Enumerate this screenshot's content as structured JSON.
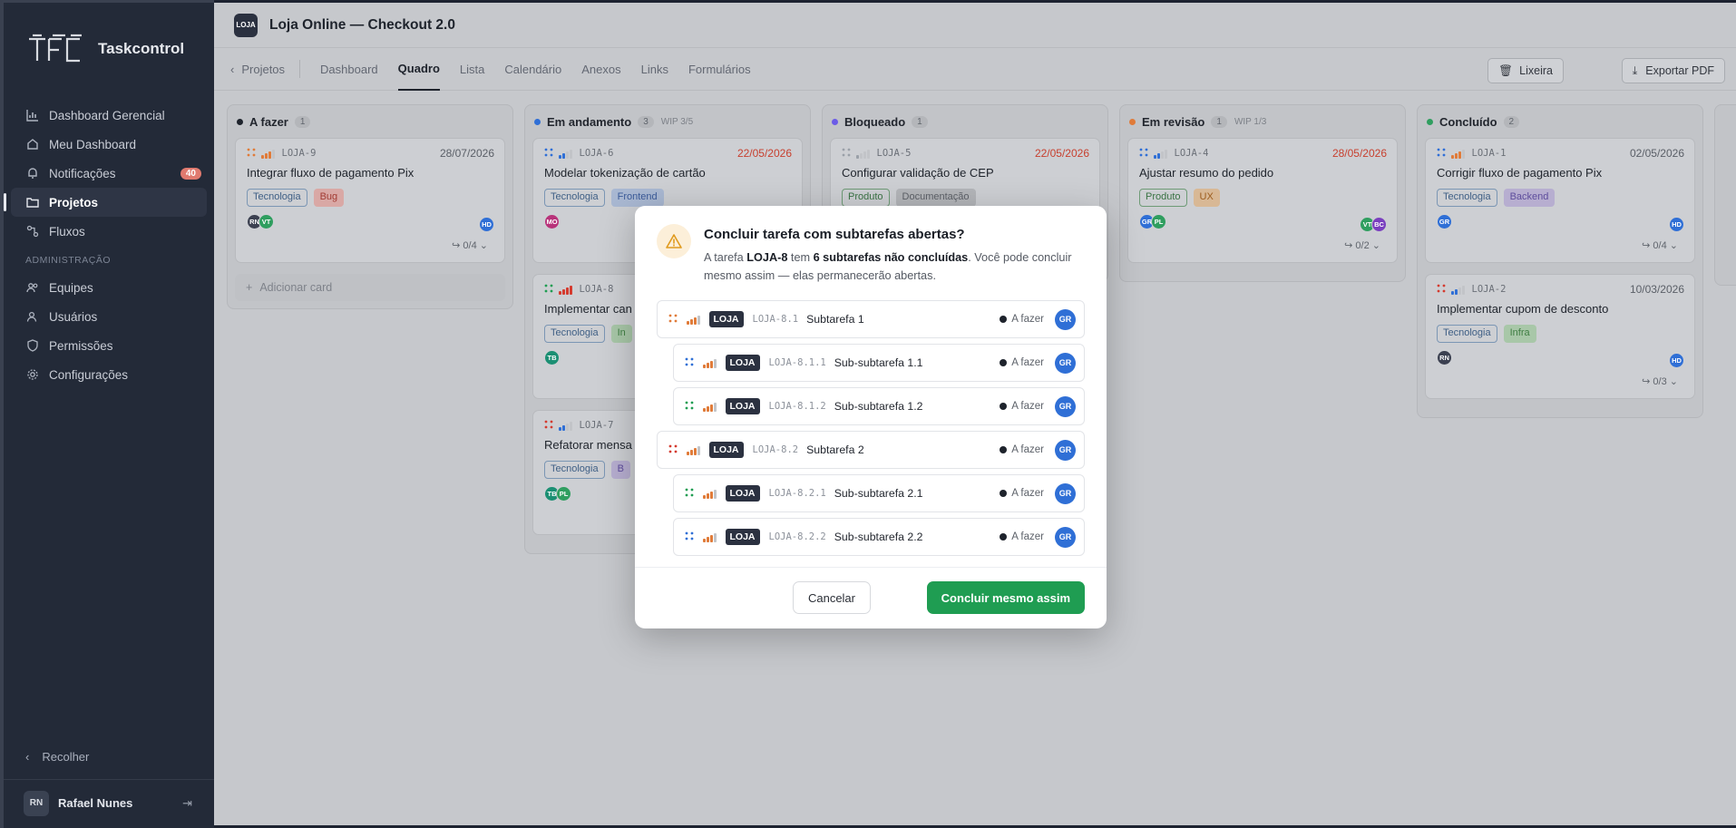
{
  "app": {
    "name": "Taskcontrol"
  },
  "sidebar": {
    "items": [
      {
        "label": "Dashboard Gerencial",
        "icon": "bar-chart-icon"
      },
      {
        "label": "Meu Dashboard",
        "icon": "home-icon"
      },
      {
        "label": "Notificações",
        "icon": "bell-icon",
        "count": "40"
      },
      {
        "label": "Projetos",
        "icon": "folder-icon",
        "active": true
      },
      {
        "label": "Fluxos",
        "icon": "flow-icon"
      }
    ],
    "section_label": "ADMINISTRAÇÃO",
    "admin_items": [
      {
        "label": "Equipes",
        "icon": "team-icon"
      },
      {
        "label": "Usuários",
        "icon": "users-icon"
      },
      {
        "label": "Permissões",
        "icon": "shield-icon"
      },
      {
        "label": "Configurações",
        "icon": "gear-icon"
      }
    ],
    "collapse_label": "Recolher",
    "user": {
      "initials": "RN",
      "name": "Rafael Nunes"
    }
  },
  "project": {
    "badge": "LOJA",
    "title": "Loja Online — Checkout 2.0"
  },
  "tabs": {
    "back": "Projetos",
    "items": [
      "Dashboard",
      "Quadro",
      "Lista",
      "Calendário",
      "Anexos",
      "Links",
      "Formulários"
    ],
    "active": "Quadro"
  },
  "actions": {
    "trash": "Lixeira",
    "export": "Exportar PDF"
  },
  "columns": [
    {
      "name": "A fazer",
      "count": "1",
      "wip": "",
      "color": "#1e232c",
      "cards": [
        {
          "key": "LOJA-9",
          "date": "28/07/2026",
          "late": false,
          "title": "Integrar fluxo de pagamento Pix",
          "tags": [
            {
              "t": "Tecnologia",
              "c": "tec"
            },
            {
              "t": "Bug",
              "c": "red"
            }
          ],
          "avatars": [
            {
              "i": "RN",
              "c": "#3b4050"
            },
            {
              "i": "VT",
              "c": "#2f9e5f"
            }
          ],
          "right_avatar": {
            "i": "HD",
            "c": "#2f6fd6"
          },
          "subcount": "0/4"
        }
      ],
      "add_label": "Adicionar card"
    },
    {
      "name": "Em andamento",
      "count": "3",
      "wip": "WIP 3/5",
      "color": "#2f6fd6",
      "cards": [
        {
          "key": "LOJA-6",
          "date": "22/05/2026",
          "late": true,
          "title": "Modelar tokenização de cartão",
          "tags": [
            {
              "t": "Tecnologia",
              "c": "tec"
            },
            {
              "t": "Frontend",
              "c": "blue"
            }
          ],
          "avatars": [
            {
              "i": "MO",
              "c": "#b8337a"
            }
          ],
          "right_avatar": null,
          "subcount": ""
        },
        {
          "key": "LOJA-8",
          "date": "",
          "late": false,
          "title": "Implementar can",
          "tags": [
            {
              "t": "Tecnologia",
              "c": "tec"
            },
            {
              "t": "In",
              "c": "green"
            }
          ],
          "avatars": [
            {
              "i": "TB",
              "c": "#1b8f73"
            }
          ],
          "right_avatar": null,
          "subcount": ""
        },
        {
          "key": "LOJA-7",
          "date": "",
          "late": false,
          "title": "Refatorar mensa",
          "tags": [
            {
              "t": "Tecnologia",
              "c": "tec"
            },
            {
              "t": "B",
              "c": "purple"
            }
          ],
          "avatars": [
            {
              "i": "TB",
              "c": "#1b8f73"
            },
            {
              "i": "PL",
              "c": "#2f9e5f"
            }
          ],
          "right_avatar": null,
          "subcount": ""
        }
      ]
    },
    {
      "name": "Bloqueado",
      "count": "1",
      "wip": "",
      "color": "#6c5ce7",
      "cards": [
        {
          "key": "LOJA-5",
          "date": "22/05/2026",
          "late": true,
          "title": "Configurar validação de CEP",
          "tags": [
            {
              "t": "Produto",
              "c": "prod"
            },
            {
              "t": "Documentação",
              "c": "doc"
            }
          ],
          "avatars": [],
          "right_avatar": null,
          "subcount": ""
        }
      ]
    },
    {
      "name": "Em revisão",
      "count": "1",
      "wip": "WIP 1/3",
      "color": "#e07b39",
      "cards": [
        {
          "key": "LOJA-4",
          "date": "28/05/2026",
          "late": true,
          "title": "Ajustar resumo do pedido",
          "tags": [
            {
              "t": "Produto",
              "c": "prod"
            },
            {
              "t": "UX",
              "c": "ux"
            }
          ],
          "avatars": [
            {
              "i": "GR",
              "c": "#2f6fd6"
            },
            {
              "i": "PL",
              "c": "#2f9e5f"
            }
          ],
          "right_avatar": {
            "i": "VT",
            "c": "#2f9e5f"
          },
          "right_avatar2": {
            "i": "BC",
            "c": "#7a3fbf"
          },
          "subcount": "0/2"
        }
      ]
    },
    {
      "name": "Concluído",
      "count": "2",
      "wip": "",
      "color": "#2f9e5f",
      "cards": [
        {
          "key": "LOJA-1",
          "date": "02/05/2026",
          "late": false,
          "title": "Corrigir fluxo de pagamento Pix",
          "tags": [
            {
              "t": "Tecnologia",
              "c": "tec"
            },
            {
              "t": "Backend",
              "c": "purple"
            }
          ],
          "avatars": [
            {
              "i": "GR",
              "c": "#2f6fd6"
            }
          ],
          "right_avatar": {
            "i": "HD",
            "c": "#2f6fd6"
          },
          "subcount": "0/4"
        },
        {
          "key": "LOJA-2",
          "date": "10/03/2026",
          "late": false,
          "title": "Implementar cupom de desconto",
          "tags": [
            {
              "t": "Tecnologia",
              "c": "tec"
            },
            {
              "t": "Infra",
              "c": "green"
            }
          ],
          "avatars": [
            {
              "i": "RN",
              "c": "#3b4050"
            }
          ],
          "right_avatar": {
            "i": "HD",
            "c": "#2f6fd6"
          },
          "subcount": "0/3"
        }
      ]
    }
  ],
  "modal": {
    "title": "Concluir tarefa com subtarefas abertas?",
    "desc_prefix": "A tarefa ",
    "task_key": "LOJA-8",
    "desc_mid": " tem ",
    "open_count": "6 subtarefas não concluídas",
    "desc_suffix": ". Você pode concluir mesmo assim — elas permanecerão abertas.",
    "subtasks": [
      {
        "badge": "LOJA",
        "key": "LOJA-8.1",
        "title": "Subtarefa 1",
        "status": "A fazer",
        "assignee": "GR",
        "child": false,
        "type_color": "#e07b39"
      },
      {
        "badge": "LOJA",
        "key": "LOJA-8.1.1",
        "title": "Sub-subtarefa 1.1",
        "status": "A fazer",
        "assignee": "GR",
        "child": true,
        "type_color": "#2f6fd6"
      },
      {
        "badge": "LOJA",
        "key": "LOJA-8.1.2",
        "title": "Sub-subtarefa 1.2",
        "status": "A fazer",
        "assignee": "GR",
        "child": true,
        "type_color": "#1f9d52"
      },
      {
        "badge": "LOJA",
        "key": "LOJA-8.2",
        "title": "Subtarefa 2",
        "status": "A fazer",
        "assignee": "GR",
        "child": false,
        "type_color": "#d43b2f"
      },
      {
        "badge": "LOJA",
        "key": "LOJA-8.2.1",
        "title": "Sub-subtarefa 2.1",
        "status": "A fazer",
        "assignee": "GR",
        "child": true,
        "type_color": "#1f9d52"
      },
      {
        "badge": "LOJA",
        "key": "LOJA-8.2.2",
        "title": "Sub-subtarefa 2.2",
        "status": "A fazer",
        "assignee": "GR",
        "child": true,
        "type_color": "#2f6fd6"
      }
    ],
    "cancel_label": "Cancelar",
    "confirm_label": "Concluir mesmo assim"
  }
}
